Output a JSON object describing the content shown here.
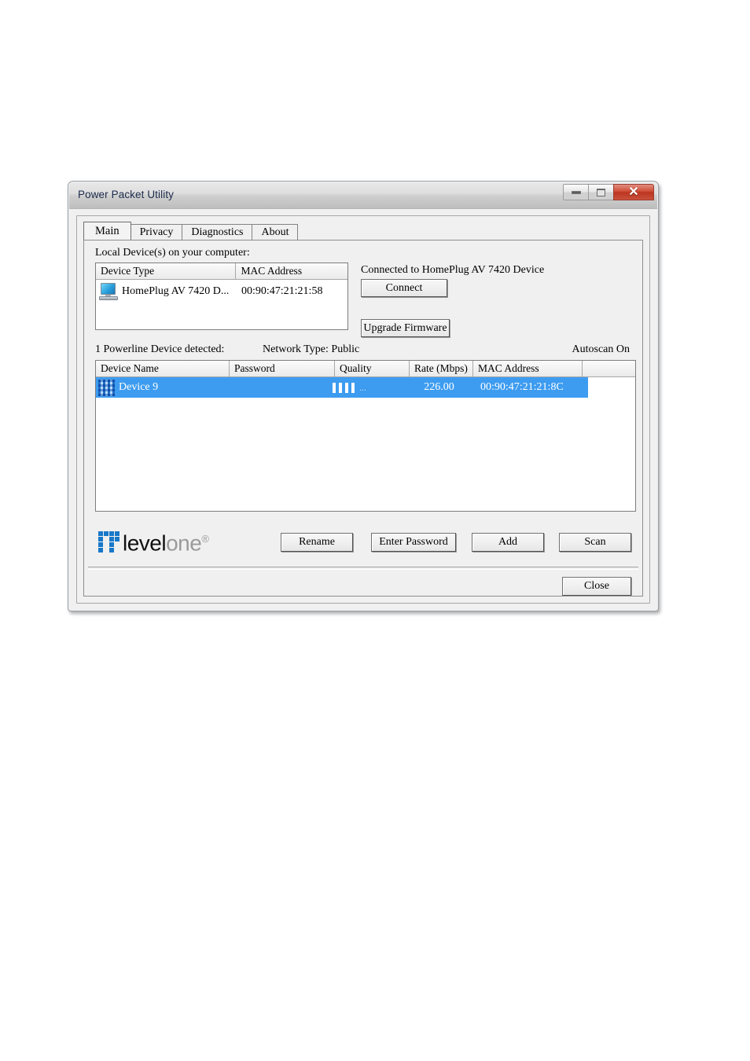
{
  "window": {
    "title": "Power Packet Utility",
    "controls": {
      "minimize": "minimize-button",
      "maximize": "maximize-button",
      "close": "✕"
    }
  },
  "tabs": [
    {
      "label": "Main",
      "active": true
    },
    {
      "label": "Privacy",
      "active": false
    },
    {
      "label": "Diagnostics",
      "active": false
    },
    {
      "label": "About",
      "active": false
    }
  ],
  "local_devices": {
    "label": "Local Device(s) on your computer:",
    "columns": [
      "Device Type",
      "MAC Address"
    ],
    "rows": [
      {
        "icon": "computer-icon",
        "device_type": "HomePlug AV 7420 D...",
        "mac_address": "00:90:47:21:21:58"
      }
    ]
  },
  "connection": {
    "status": "Connected to HomePlug AV 7420 Device",
    "connect_label": "Connect",
    "upgrade_label": "Upgrade Firmware"
  },
  "powerline": {
    "detected": "1 Powerline Device detected:",
    "network_type": "Network Type: Public",
    "autoscan": "Autoscan On",
    "columns": [
      "Device Name",
      "Password",
      "Quality",
      "Rate (Mbps)",
      "MAC Address",
      ""
    ],
    "rows": [
      {
        "icon": "device-grid-icon",
        "device_name": "Device 9",
        "password": "",
        "quality_bars": 4,
        "quality_suffix": "...",
        "rate_mbps": "226.00",
        "mac_address": "00:90:47:21:21:8C",
        "selected": true
      }
    ]
  },
  "brand": {
    "name_primary": "level",
    "name_secondary": "one",
    "registered": "®"
  },
  "actions": {
    "rename": "Rename",
    "enter_password": "Enter Password",
    "add": "Add",
    "scan": "Scan",
    "close": "Close"
  },
  "colors": {
    "selection_blue": "#3d9cf0",
    "brand_blue": "#1878c8",
    "close_red": "#bd3620",
    "dialog_face": "#f0f0f0"
  }
}
